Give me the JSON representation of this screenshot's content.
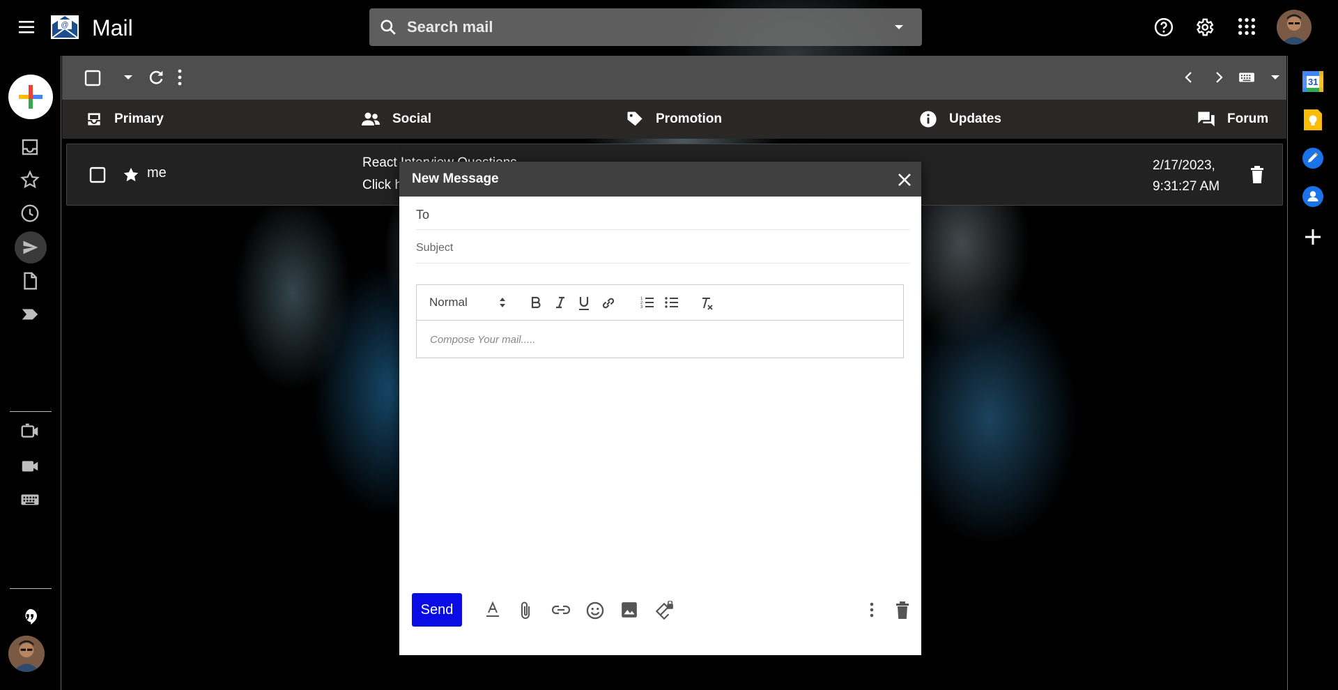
{
  "header": {
    "app_title": "Mail",
    "search_placeholder": "Search mail",
    "icons": [
      "menu-icon",
      "mail-logo-icon",
      "search-icon",
      "dropdown-icon",
      "help-icon",
      "settings-icon",
      "apps-icon",
      "avatar"
    ]
  },
  "left_rail": {
    "icons": [
      "compose-icon",
      "inbox-icon",
      "star-icon",
      "clock-icon",
      "send-icon",
      "draft-icon",
      "label-icon",
      "video-icon",
      "camera-icon",
      "keyboard-icon",
      "chat-icon",
      "avatar"
    ]
  },
  "toolbar": {
    "icons": [
      "checkbox-icon",
      "dropdown-icon",
      "refresh-icon",
      "more-icon",
      "chevron-left-icon",
      "chevron-right-icon",
      "keyboard-icon",
      "dropdown-icon"
    ]
  },
  "tabs": [
    {
      "label": "Primary",
      "icon": "inbox-icon"
    },
    {
      "label": "Social",
      "icon": "people-icon"
    },
    {
      "label": "Promotion",
      "icon": "tag-icon"
    },
    {
      "label": "Updates",
      "icon": "info-icon"
    },
    {
      "label": "Forum",
      "icon": "forum-icon"
    }
  ],
  "email": {
    "sender": "me",
    "subject": "React Interview Questions",
    "snippet": "Click h",
    "date_line1": "2/17/2023,",
    "date_line2": "9:31:27 AM"
  },
  "compose": {
    "title": "New Message",
    "to_placeholder": "To",
    "subject_placeholder": "Subject",
    "format_select": "Normal",
    "body_placeholder": "Compose Your mail.....",
    "send_label": "Send",
    "colors": {
      "send": "#0b0be6",
      "header": "#404040"
    }
  },
  "right_rail": {
    "calendar_day": "31",
    "icons": [
      "calendar-icon",
      "keep-icon",
      "tasks-icon",
      "contacts-icon",
      "add-icon"
    ]
  }
}
